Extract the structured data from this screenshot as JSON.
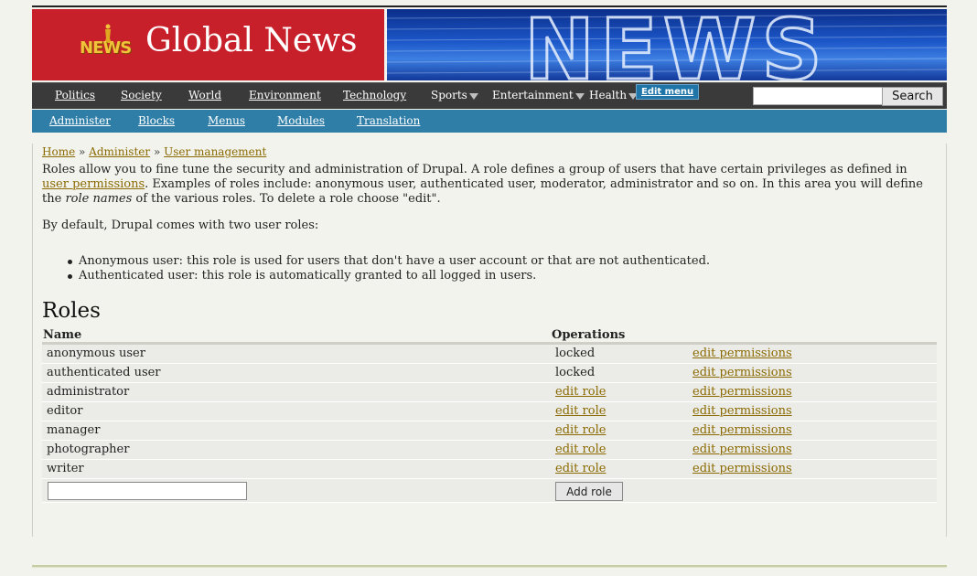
{
  "site": {
    "title": "Global News",
    "logo_text": "NEWS",
    "banner_text": "NEWS"
  },
  "primary_nav": {
    "items": [
      {
        "label": "Politics"
      },
      {
        "label": "Society"
      },
      {
        "label": "World"
      },
      {
        "label": "Environment"
      },
      {
        "label": "Technology"
      },
      {
        "label": "Sports"
      },
      {
        "label": "Entertainment"
      },
      {
        "label": "Health"
      }
    ],
    "edit_menu_label": "Edit menu",
    "search": {
      "value": "",
      "button_label": "Search"
    }
  },
  "secondary_nav": {
    "items": [
      {
        "label": "Administer"
      },
      {
        "label": "Blocks"
      },
      {
        "label": "Menus"
      },
      {
        "label": "Modules"
      },
      {
        "label": "Translation"
      }
    ]
  },
  "breadcrumb": {
    "home": "Home",
    "sep": "»",
    "administer": "Administer",
    "user_management": "User management"
  },
  "intro": {
    "p1_a": "Roles allow you to fine tune the security and administration of Drupal. A role defines a group of users that have certain privileges as defined in ",
    "p1_link": "user permissions",
    "p1_b": ". Examples of roles include: anonymous user, authenticated user, moderator, administrator and so on. In this area you will define the ",
    "p1_em": "role names",
    "p1_c": " of the various roles. To delete a role choose \"edit\".",
    "p2": "By default, Drupal comes with two user roles:",
    "bullets": [
      "Anonymous user: this role is used for users that don't have a user account or that are not authenticated.",
      "Authenticated user: this role is automatically granted to all logged in users."
    ]
  },
  "roles": {
    "heading": "Roles",
    "col_name": "Name",
    "col_operations": "Operations",
    "rows": [
      {
        "name": "anonymous user",
        "op1": "locked",
        "op2": "edit permissions"
      },
      {
        "name": "authenticated user",
        "op1": "locked",
        "op2": "edit permissions"
      },
      {
        "name": "administrator",
        "op1": "edit role",
        "op2": "edit permissions"
      },
      {
        "name": "editor",
        "op1": "edit role",
        "op2": "edit permissions"
      },
      {
        "name": "manager",
        "op1": "edit role",
        "op2": "edit permissions"
      },
      {
        "name": "photographer",
        "op1": "edit role",
        "op2": "edit permissions"
      },
      {
        "name": "writer",
        "op1": "edit role",
        "op2": "edit permissions"
      }
    ],
    "new_role_value": "",
    "add_button": "Add role"
  },
  "colors": {
    "banner_red": "#c8202a",
    "nav_dark": "#3a3a3a",
    "nav_blue": "#2f7ea7",
    "link": "#8a6a00"
  }
}
